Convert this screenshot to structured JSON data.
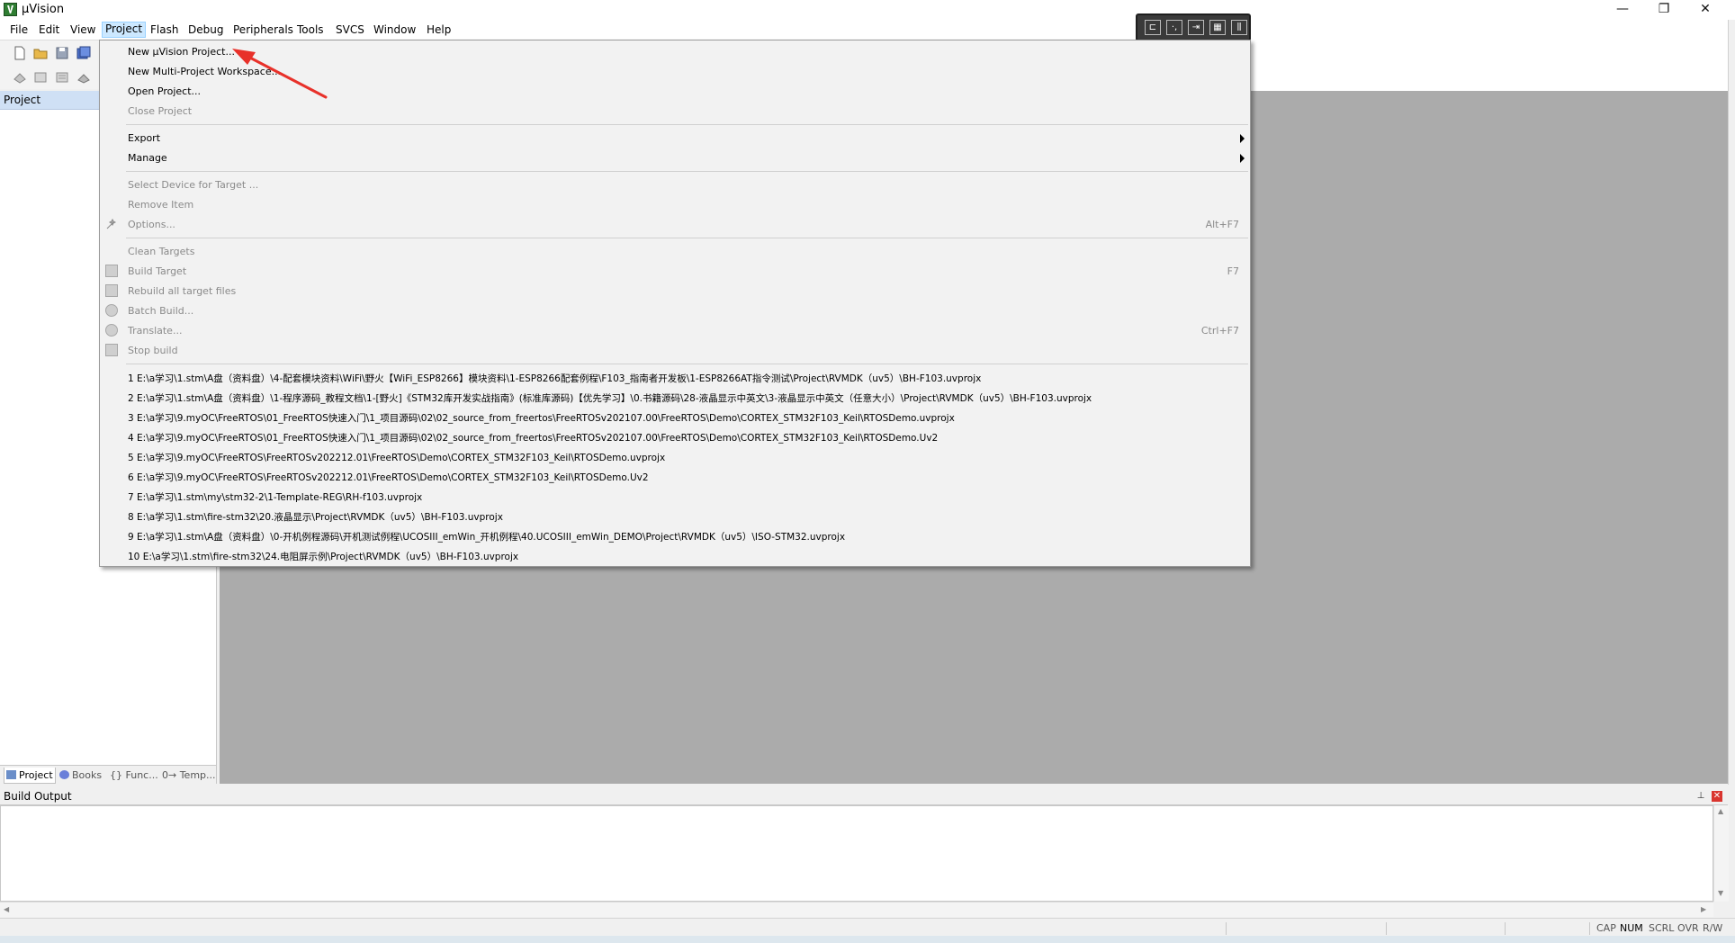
{
  "window": {
    "title": "µVision",
    "minimize": "—",
    "restore": "❐",
    "close": "✕"
  },
  "menubar": {
    "items": [
      "File",
      "Edit",
      "View",
      "Project",
      "Flash",
      "Debug",
      "Peripherals",
      "Tools",
      "SVCS",
      "Window",
      "Help"
    ],
    "active": "Project"
  },
  "float_toolbar": {
    "buttons": [
      "window-split-icon",
      "cursor-icon",
      "indent-icon",
      "keyboard-icon",
      "columns-icon"
    ]
  },
  "project_pane": {
    "title": "Project",
    "tabs": [
      "Project",
      "Books",
      "{} Func...",
      "0→ Temp..."
    ]
  },
  "project_menu": {
    "new_project": "New µVision Project...",
    "new_workspace": "New Multi-Project Workspace...",
    "open_project": "Open Project...",
    "close_project": "Close Project",
    "export": "Export",
    "manage": "Manage",
    "select_device": "Select Device for Target ...",
    "remove_item": "Remove Item",
    "options": "Options...",
    "options_shortcut": "Alt+F7",
    "clean_targets": "Clean Targets",
    "build_target": "Build Target",
    "build_shortcut": "F7",
    "rebuild_all": "Rebuild all target files",
    "batch_build": "Batch Build...",
    "translate": "Translate...",
    "translate_shortcut": "Ctrl+F7",
    "stop_build": "Stop build",
    "recent": [
      "1 E:\\a学习\\1.stm\\A盘（资料盘）\\4-配套模块资料\\WiFi\\野火【WiFi_ESP8266】模块资料\\1-ESP8266配套例程\\F103_指南者开发板\\1-ESP8266AT指令测试\\Project\\RVMDK（uv5）\\BH-F103.uvprojx",
      "2 E:\\a学习\\1.stm\\A盘（资料盘）\\1-程序源码_教程文档\\1-[野火]《STM32库开发实战指南》(标准库源码)【优先学习】\\0.书籍源码\\28-液晶显示中英文\\3-液晶显示中英文（任意大小）\\Project\\RVMDK（uv5）\\BH-F103.uvprojx",
      "3 E:\\a学习\\9.myOC\\FreeRTOS\\01_FreeRTOS快速入门\\1_项目源码\\02\\02_source_from_freertos\\FreeRTOSv202107.00\\FreeRTOS\\Demo\\CORTEX_STM32F103_Keil\\RTOSDemo.uvprojx",
      "4 E:\\a学习\\9.myOC\\FreeRTOS\\01_FreeRTOS快速入门\\1_项目源码\\02\\02_source_from_freertos\\FreeRTOSv202107.00\\FreeRTOS\\Demo\\CORTEX_STM32F103_Keil\\RTOSDemo.Uv2",
      "5 E:\\a学习\\9.myOC\\FreeRTOS\\FreeRTOSv202212.01\\FreeRTOS\\Demo\\CORTEX_STM32F103_Keil\\RTOSDemo.uvprojx",
      "6 E:\\a学习\\9.myOC\\FreeRTOS\\FreeRTOSv202212.01\\FreeRTOS\\Demo\\CORTEX_STM32F103_Keil\\RTOSDemo.Uv2",
      "7 E:\\a学习\\1.stm\\my\\stm32-2\\1-Template-REG\\RH-f103.uvprojx",
      "8 E:\\a学习\\1.stm\\fire-stm32\\20.液晶显示\\Project\\RVMDK（uv5）\\BH-F103.uvprojx",
      "9 E:\\a学习\\1.stm\\A盘（资料盘）\\0-开机例程源码\\开机测试例程\\UCOSIII_emWin_开机例程\\40.UCOSIII_emWin_DEMO\\Project\\RVMDK（uv5）\\ISO-STM32.uvprojx",
      "10 E:\\a学习\\1.stm\\fire-stm32\\24.电阻屏示例\\Project\\RVMDK（uv5）\\BH-F103.uvprojx"
    ]
  },
  "build_output": {
    "title": "Build Output",
    "pin": "⊥",
    "close": "✕"
  },
  "statusbar": {
    "keys": [
      "CAP",
      "NUM",
      "SCRL",
      "OVR",
      "R/W"
    ],
    "active": [
      "NUM"
    ]
  },
  "colors": {
    "annotation_arrow": "#e8312a",
    "menu_highlight": "#cce8ff",
    "editor_bg": "#ababab"
  }
}
